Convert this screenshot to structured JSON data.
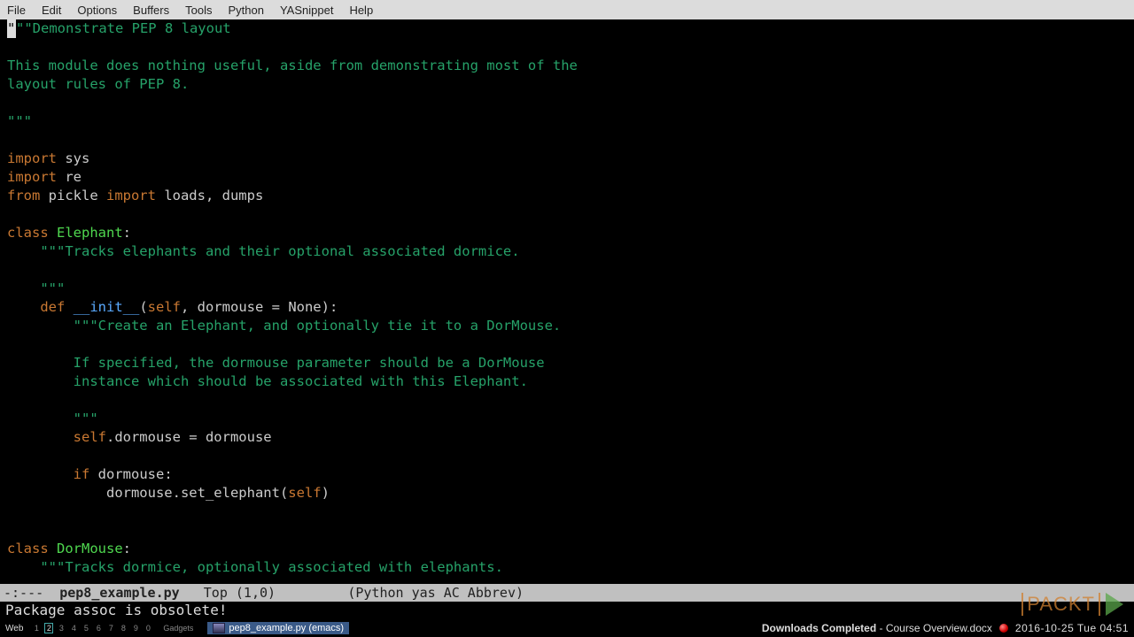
{
  "menubar": {
    "items": [
      "File",
      "Edit",
      "Options",
      "Buffers",
      "Tools",
      "Python",
      "YASnippet",
      "Help"
    ]
  },
  "code": {
    "l1a": "\"",
    "l1b": "\"\"Demonstrate PEP 8 layout",
    "l2": "",
    "l3": "This module does nothing useful, aside from demonstrating most of the",
    "l4": "layout rules of PEP 8.",
    "l5": "",
    "l6": "\"\"\"",
    "l7": "",
    "imp": "import",
    "sys": " sys",
    "re": " re",
    "from": "from",
    "pickle": " pickle ",
    "loads": " loads, dumps",
    "cls": "class",
    "elephant": " Elephant",
    "colon": ":",
    "eledoc1": "    \"\"\"Tracks elephants and their optional associated dormice.",
    "eledoc2": "",
    "eledoc3": "    \"\"\"",
    "def": "def",
    "init": " __init__",
    "lparen": "(",
    "self": "self",
    "initargs": ", dormouse = None):",
    "initdoc1": "        \"\"\"Create an Elephant, and optionally tie it to a DorMouse.",
    "initdoc2": "",
    "initdoc3": "        If specified, the dormouse parameter should be a DorMouse",
    "initdoc4": "        instance which should be associated with this Elephant.",
    "initdoc5": "",
    "initdoc6": "        \"\"\"",
    "assign1a": "        ",
    "assign1b": ".dormouse = dormouse",
    "if": "if",
    "ifcond": " dormouse:",
    "call1": "            dormouse.set_elephant(",
    "call2": ")",
    "dormouse": " DorMouse",
    "dordoc": "    \"\"\"Tracks dormice, optionally associated with elephants."
  },
  "modeline": {
    "prefix": "-:---  ",
    "filename": "pep8_example.py",
    "position": "   Top (1,0)         ",
    "modes": "(Python yas AC Abbrev)"
  },
  "minibuffer": {
    "text": "Package assoc is obsolete!"
  },
  "taskbar": {
    "web": "Web",
    "pager": [
      "1",
      "2",
      "3",
      "4",
      "5",
      "6",
      "7",
      "8",
      "9",
      "0"
    ],
    "active_pager": 1,
    "gadgets": "Gadgets",
    "app": "pep8_example.py (emacs)",
    "notif_bold": "Downloads Completed",
    "notif_rest": " - Course Overview.docx",
    "clock": "2016-10-25 Tue 04:51"
  },
  "watermark": {
    "logo": "PACKT"
  }
}
